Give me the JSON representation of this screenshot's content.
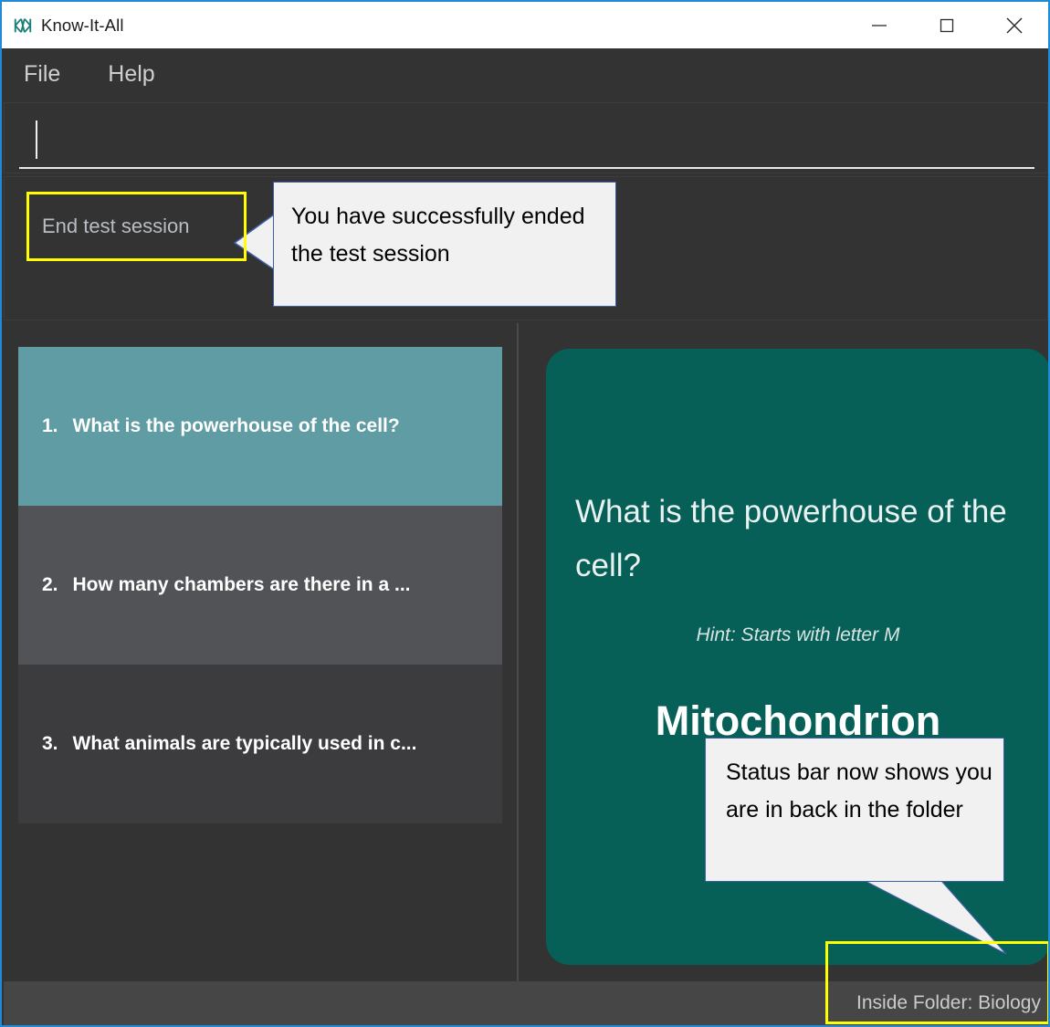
{
  "window": {
    "title": "Know-It-All",
    "icon": "app-logo-icon",
    "minimize_label": "Minimize",
    "maximize_label": "Maximize",
    "close_label": "Close",
    "accent_border": "#1f8bd4"
  },
  "menu": {
    "items": [
      {
        "label": "File"
      },
      {
        "label": "Help"
      }
    ]
  },
  "answer_input": {
    "value": "",
    "placeholder": ""
  },
  "session": {
    "end_button_label": "End test session"
  },
  "question_list": {
    "items": [
      {
        "number": "1.",
        "text": "What is the powerhouse of the cell?",
        "state": "selected"
      },
      {
        "number": "2.",
        "text": "How many chambers are there in a ...",
        "state": "alt"
      },
      {
        "number": "3.",
        "text": "What animals are typically used in c...",
        "state": "plain"
      }
    ]
  },
  "flashcard": {
    "question": "What is the powerhouse of the cell?",
    "hint": "Hint: Starts with letter M",
    "answer": "Mitochondrion",
    "background": "#076058"
  },
  "status_bar": {
    "text": "Inside Folder: Biology"
  },
  "callouts": [
    {
      "text": "You have successfully ended the test session"
    },
    {
      "text": "Status bar now shows you are in back in the folder"
    }
  ],
  "highlights": {
    "color": "#ffff00",
    "end_session": "End test session button",
    "status": "Status bar folder label"
  },
  "colors": {
    "selected_item": "#5f9ca3",
    "alt_item": "#515356",
    "plain_item": "#3c3c3e",
    "window_bg": "#333333",
    "status_bg": "#464646",
    "callout_border": "#3f60a8"
  }
}
